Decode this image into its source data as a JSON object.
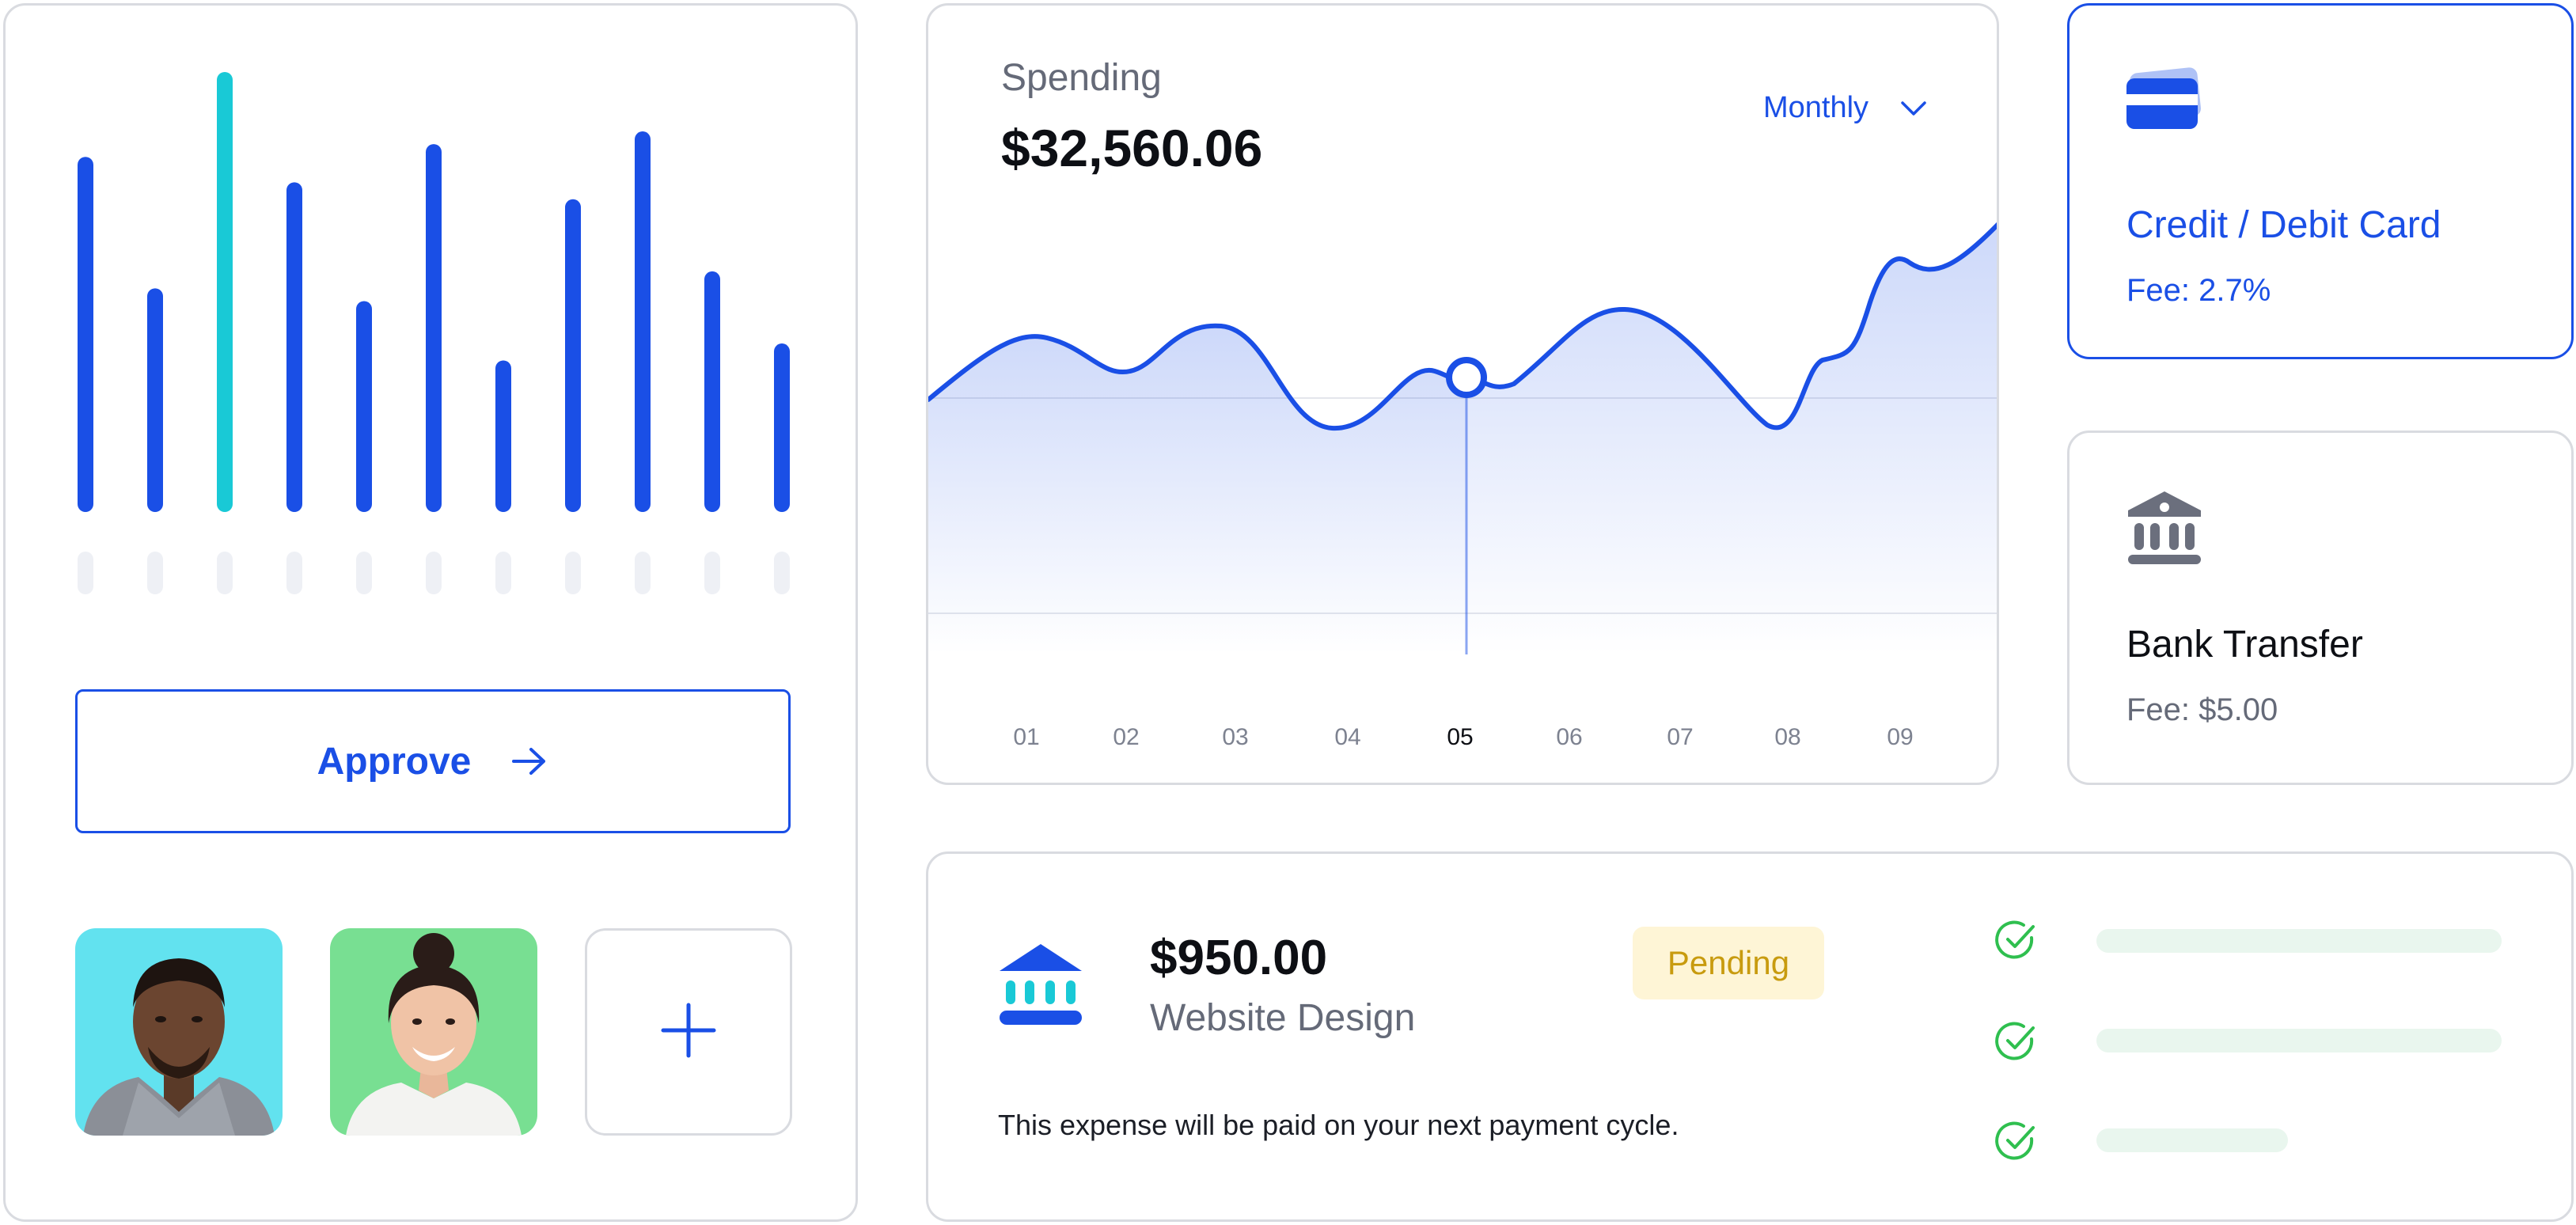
{
  "colors": {
    "accent": "#1a4fe6",
    "highlight_bar": "#19c9d6",
    "border": "#d9dbe0",
    "success": "#2fbf4f",
    "pending_bg": "#fef5d6",
    "pending_text": "#c89b0f",
    "muted_text": "#656a78"
  },
  "bars": {
    "values": [
      0.8,
      0.49,
      1.0,
      0.74,
      0.46,
      0.83,
      0.32,
      0.7,
      0.86,
      0.53,
      0.36
    ],
    "highlight_index": 2
  },
  "approve": {
    "label": "Approve",
    "icon": "arrow-right-icon"
  },
  "avatars": {
    "add_icon": "plus-icon"
  },
  "spending": {
    "label": "Spending",
    "amount": "$32,560.06",
    "period": "Monthly",
    "period_icon": "chevron-down-icon",
    "active_index": 4
  },
  "chart_data": {
    "type": "area",
    "x": [
      "01",
      "02",
      "03",
      "04",
      "05",
      "06",
      "07",
      "08",
      "09"
    ],
    "active_x": "05"
  },
  "payment_options": {
    "card": {
      "title": "Credit / Debit Card",
      "fee": "Fee: 2.7%",
      "icon": "credit-card-icon"
    },
    "bank": {
      "title": "Bank Transfer",
      "fee": "Fee: $5.00",
      "icon": "bank-icon"
    }
  },
  "expense": {
    "amount": "$950.00",
    "title": "Website Design",
    "status": "Pending",
    "note": "This expense will be paid on your next payment cycle.",
    "icon": "bank-icon",
    "checklist_icon": "check-circle-icon",
    "checklist_count": 3
  }
}
